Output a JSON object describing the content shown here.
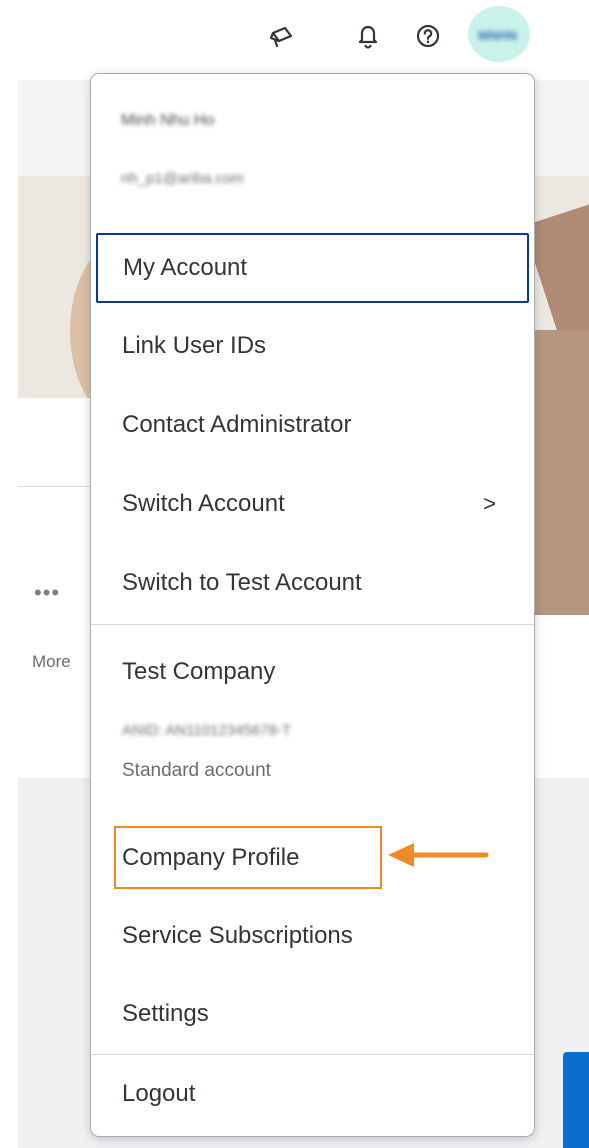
{
  "header": {
    "icons": [
      "megaphone-icon",
      "bell-icon",
      "help-icon"
    ],
    "avatar_text": "MNHN",
    "avatar_color": "#c9f2ea"
  },
  "background": {
    "more_label": "More",
    "dots": "•••"
  },
  "menu": {
    "user_name": "Minh Nhu Ho",
    "user_email": "nh_p1@ariba.com",
    "items_top": [
      {
        "label": "My Account"
      },
      {
        "label": "Link User IDs"
      },
      {
        "label": "Contact Administrator"
      },
      {
        "label": "Switch Account",
        "chevron": ">"
      },
      {
        "label": "Switch to Test Account"
      }
    ],
    "company": {
      "name": "Test Company",
      "id": "ANID: AN11012345678-T",
      "account_type": "Standard account"
    },
    "items_company": [
      {
        "label": "Company Profile"
      },
      {
        "label": "Service Subscriptions"
      },
      {
        "label": "Settings"
      }
    ],
    "logout_label": "Logout"
  },
  "annotation": {
    "color": "#f08a24"
  },
  "colors": {
    "focus_border": "#0a3a8c",
    "feedback_tab": "#0a6ed1"
  }
}
